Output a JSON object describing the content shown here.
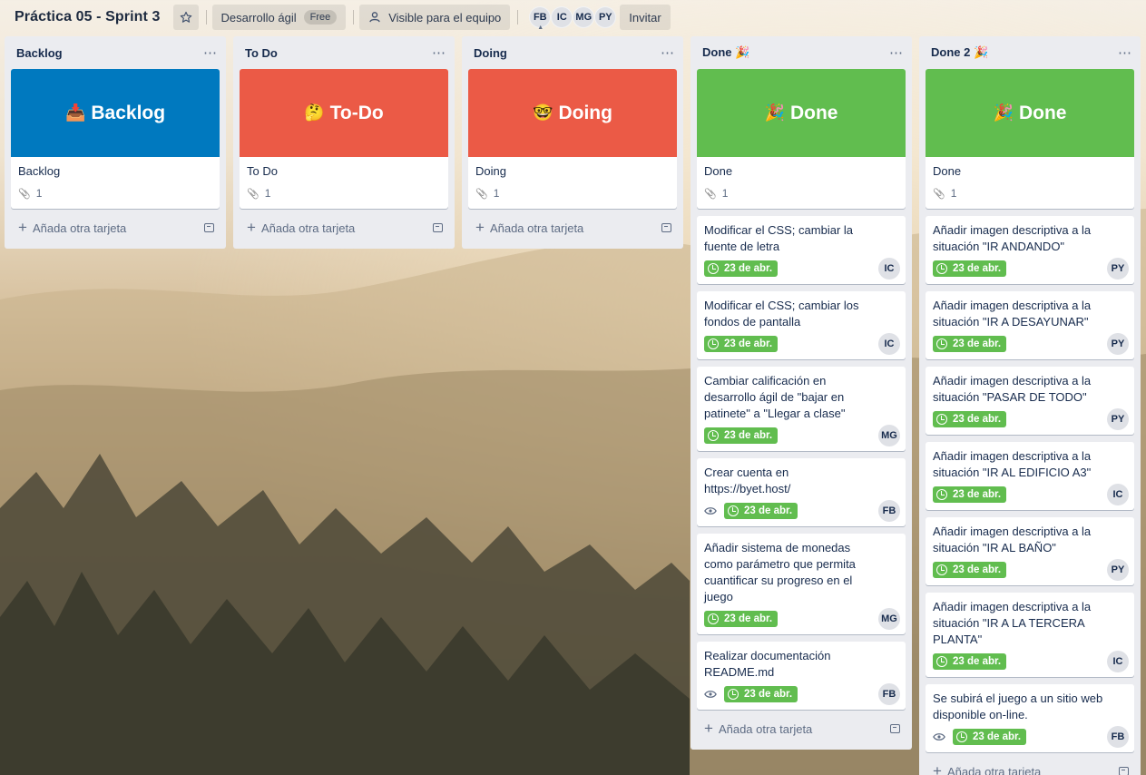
{
  "header": {
    "board_title": "Práctica 05 - Sprint 3",
    "star_icon": "star-icon",
    "workspace_label": "Desarrollo ágil",
    "workspace_badge": "Free",
    "visibility_label": "Visible para el equipo",
    "members": [
      "FB",
      "IC",
      "MG",
      "PY"
    ],
    "invite_label": "Invitar"
  },
  "colors": {
    "blue": "#0079bf",
    "red": "#eb5a46",
    "green": "#61bd4f",
    "list_bg": "#ebecf0"
  },
  "add_card_label": "Añada otra tarjeta",
  "lists": [
    {
      "title": "Backlog",
      "cover_emoji": "📥",
      "cover_text": "Backlog",
      "cover_color": "#0079bf",
      "cover_card_text": "Backlog",
      "attachments": "1",
      "cards": []
    },
    {
      "title": "To Do",
      "cover_emoji": "🤔",
      "cover_text": "To-Do",
      "cover_color": "#eb5a46",
      "cover_card_text": "To Do",
      "attachments": "1",
      "cards": []
    },
    {
      "title": "Doing",
      "cover_emoji": "🤓",
      "cover_text": "Doing",
      "cover_color": "#eb5a46",
      "cover_card_text": "Doing",
      "attachments": "1",
      "cards": []
    },
    {
      "title": "Done 🎉",
      "cover_emoji": "🎉",
      "cover_text": "Done",
      "cover_color": "#61bd4f",
      "cover_card_text": "Done",
      "attachments": "1",
      "cards": [
        {
          "text": "Modificar el CSS; cambiar la fuente de letra",
          "due": "23 de abr.",
          "watch": false,
          "member": "IC"
        },
        {
          "text": "Modificar el CSS; cambiar los fondos de pantalla",
          "due": "23 de abr.",
          "watch": false,
          "member": "IC"
        },
        {
          "text": "Cambiar calificación en desarrollo ágil de \"bajar en patinete\" a \"Llegar a clase\"",
          "due": "23 de abr.",
          "watch": false,
          "member": "MG"
        },
        {
          "text": "Crear cuenta en https://byet.host/",
          "due": "23 de abr.",
          "watch": true,
          "member": "FB"
        },
        {
          "text": "Añadir sistema de monedas como parámetro que permita cuantificar su progreso en el juego",
          "due": "23 de abr.",
          "watch": false,
          "member": "MG"
        },
        {
          "text": "Realizar documentación README.md",
          "due": "23 de abr.",
          "watch": true,
          "member": "FB"
        }
      ]
    },
    {
      "title": "Done 2 🎉",
      "cover_emoji": "🎉",
      "cover_text": "Done",
      "cover_color": "#61bd4f",
      "cover_card_text": "Done",
      "attachments": "1",
      "cards": [
        {
          "text": "Añadir imagen descriptiva a la situación \"IR ANDANDO\"",
          "due": "23 de abr.",
          "watch": false,
          "member": "PY"
        },
        {
          "text": "Añadir imagen descriptiva a la situación \"IR A DESAYUNAR\"",
          "due": "23 de abr.",
          "watch": false,
          "member": "PY"
        },
        {
          "text": "Añadir imagen descriptiva a la situación \"PASAR DE TODO\"",
          "due": "23 de abr.",
          "watch": false,
          "member": "PY"
        },
        {
          "text": "Añadir imagen descriptiva a la situación \"IR AL EDIFICIO A3\"",
          "due": "23 de abr.",
          "watch": false,
          "member": "IC"
        },
        {
          "text": "Añadir imagen descriptiva a la situación \"IR AL BAÑO\"",
          "due": "23 de abr.",
          "watch": false,
          "member": "PY"
        },
        {
          "text": "Añadir imagen descriptiva a la situación \"IR A LA TERCERA PLANTA\"",
          "due": "23 de abr.",
          "watch": false,
          "member": "IC"
        },
        {
          "text": "Se subirá el juego a un sitio web disponible on-line.",
          "due": "23 de abr.",
          "watch": true,
          "member": "FB"
        }
      ]
    }
  ]
}
